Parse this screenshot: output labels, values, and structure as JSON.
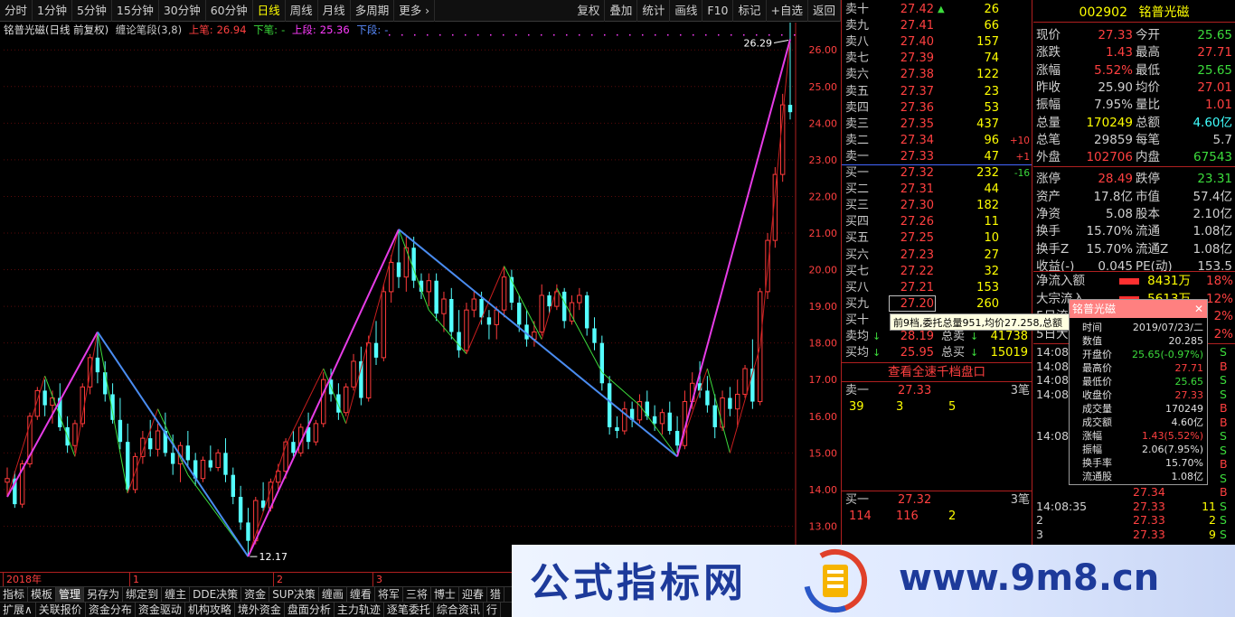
{
  "toolbar": {
    "periods": [
      {
        "label": "分时",
        "active": false
      },
      {
        "label": "1分钟",
        "active": false
      },
      {
        "label": "5分钟",
        "active": false
      },
      {
        "label": "15分钟",
        "active": false
      },
      {
        "label": "30分钟",
        "active": false
      },
      {
        "label": "60分钟",
        "active": false
      },
      {
        "label": "日线",
        "active": true
      },
      {
        "label": "周线",
        "active": false
      },
      {
        "label": "月线",
        "active": false
      },
      {
        "label": "多周期",
        "active": false
      },
      {
        "label": "更多 ›",
        "active": false
      }
    ],
    "tools": [
      "复权",
      "叠加",
      "统计",
      "画线",
      "F10",
      "标记",
      "+自选",
      "返回"
    ]
  },
  "chart_header": {
    "title": "铭普光磁(日线 前复权)",
    "indicator": "缠论笔段(3,8)",
    "up_stroke_label": "上笔:",
    "up_stroke_value": "26.94",
    "down_stroke_label": "下笔:",
    "down_stroke_value": "-",
    "up_segment_label": "上段:",
    "up_segment_value": "25.36",
    "down_segment_label": "下段:",
    "down_segment_value": "-"
  },
  "chart_data": {
    "type": "candlestick",
    "y_axis": {
      "min": 12.0,
      "max": 26.4,
      "ticks": [
        13.0,
        14.0,
        15.0,
        16.0,
        17.0,
        18.0,
        19.0,
        20.0,
        21.0,
        22.0,
        23.0,
        24.0,
        25.0,
        26.0
      ]
    },
    "annotations": {
      "high_label": "26.29",
      "low_label": "12.17"
    },
    "x_labels": [
      "2018年",
      "1",
      "2",
      "3"
    ],
    "candles": [
      [
        14.2,
        14.6,
        13.8,
        14.3
      ],
      [
        14.3,
        14.5,
        13.5,
        13.6
      ],
      [
        13.6,
        14.8,
        13.5,
        14.7
      ],
      [
        14.7,
        16.1,
        14.6,
        16.0
      ],
      [
        16.0,
        16.8,
        15.9,
        16.7
      ],
      [
        16.7,
        17.0,
        16.0,
        16.3
      ],
      [
        16.3,
        16.7,
        15.8,
        16.5
      ],
      [
        16.5,
        16.9,
        15.6,
        15.7
      ],
      [
        15.7,
        16.0,
        15.0,
        15.2
      ],
      [
        15.2,
        15.9,
        15.0,
        15.8
      ],
      [
        15.8,
        16.9,
        15.7,
        16.8
      ],
      [
        16.8,
        17.7,
        16.6,
        17.6
      ],
      [
        17.6,
        18.3,
        16.9,
        17.2
      ],
      [
        17.2,
        17.5,
        16.4,
        16.6
      ],
      [
        16.6,
        16.9,
        15.8,
        15.9
      ],
      [
        15.9,
        16.5,
        15.1,
        15.3
      ],
      [
        15.3,
        15.8,
        13.9,
        14.0
      ],
      [
        14.0,
        15.0,
        13.9,
        14.9
      ],
      [
        14.9,
        15.6,
        14.7,
        15.4
      ],
      [
        15.4,
        15.9,
        14.9,
        15.1
      ],
      [
        15.1,
        15.8,
        14.9,
        15.6
      ],
      [
        15.6,
        16.1,
        14.9,
        15.0
      ],
      [
        15.0,
        15.5,
        14.4,
        14.7
      ],
      [
        14.7,
        15.3,
        14.2,
        15.2
      ],
      [
        15.2,
        15.6,
        14.6,
        14.8
      ],
      [
        14.8,
        15.0,
        14.1,
        14.3
      ],
      [
        14.3,
        14.9,
        14.2,
        14.8
      ],
      [
        14.8,
        15.2,
        14.5,
        14.6
      ],
      [
        14.6,
        15.1,
        14.5,
        15.0
      ],
      [
        15.0,
        15.4,
        14.2,
        14.4
      ],
      [
        14.4,
        14.6,
        13.6,
        13.8
      ],
      [
        13.8,
        14.1,
        12.9,
        13.1
      ],
      [
        13.1,
        13.5,
        12.2,
        12.6
      ],
      [
        12.6,
        13.8,
        12.5,
        13.7
      ],
      [
        13.7,
        14.2,
        13.4,
        13.5
      ],
      [
        13.5,
        14.3,
        13.4,
        14.2
      ],
      [
        14.2,
        14.7,
        14.0,
        14.5
      ],
      [
        14.5,
        15.4,
        14.3,
        15.3
      ],
      [
        15.3,
        15.6,
        14.9,
        15.0
      ],
      [
        15.0,
        15.8,
        14.9,
        15.7
      ],
      [
        15.7,
        16.1,
        15.1,
        15.3
      ],
      [
        15.3,
        15.9,
        15.2,
        15.8
      ],
      [
        15.8,
        17.2,
        15.7,
        17.0
      ],
      [
        17.0,
        17.3,
        16.4,
        16.6
      ],
      [
        16.6,
        16.9,
        15.9,
        16.1
      ],
      [
        16.1,
        16.9,
        16.0,
        16.8
      ],
      [
        16.8,
        17.7,
        16.7,
        17.5
      ],
      [
        17.5,
        17.9,
        16.3,
        16.5
      ],
      [
        16.5,
        18.2,
        16.4,
        18.0
      ],
      [
        18.0,
        18.6,
        17.4,
        17.6
      ],
      [
        17.6,
        19.6,
        17.5,
        19.4
      ],
      [
        19.4,
        20.4,
        19.1,
        20.2
      ],
      [
        20.2,
        21.1,
        19.5,
        19.8
      ],
      [
        19.8,
        20.9,
        19.4,
        20.6
      ],
      [
        20.6,
        20.9,
        19.5,
        19.7
      ],
      [
        19.7,
        19.9,
        19.2,
        19.4
      ],
      [
        19.4,
        19.9,
        19.0,
        19.7
      ],
      [
        19.7,
        19.9,
        18.6,
        18.8
      ],
      [
        18.8,
        19.4,
        18.3,
        19.2
      ],
      [
        19.2,
        19.5,
        18.1,
        18.3
      ],
      [
        18.3,
        18.9,
        17.6,
        17.8
      ],
      [
        17.8,
        19.1,
        17.7,
        18.9
      ],
      [
        18.9,
        19.4,
        18.7,
        19.2
      ],
      [
        19.2,
        19.4,
        18.5,
        18.7
      ],
      [
        18.7,
        18.9,
        18.1,
        18.5
      ],
      [
        18.5,
        19.0,
        18.1,
        18.9
      ],
      [
        18.9,
        20.1,
        18.7,
        19.8
      ],
      [
        19.8,
        20.0,
        18.9,
        19.1
      ],
      [
        19.1,
        19.3,
        18.3,
        18.5
      ],
      [
        18.5,
        18.9,
        17.9,
        18.1
      ],
      [
        18.1,
        18.6,
        17.9,
        18.3
      ],
      [
        18.3,
        19.6,
        18.2,
        19.3
      ],
      [
        19.3,
        19.4,
        18.8,
        19.0
      ],
      [
        19.0,
        19.6,
        18.9,
        19.4
      ],
      [
        19.4,
        19.5,
        18.4,
        18.6
      ],
      [
        18.6,
        19.3,
        18.5,
        19.1
      ],
      [
        19.1,
        19.5,
        18.9,
        19.3
      ],
      [
        19.3,
        19.4,
        18.2,
        18.4
      ],
      [
        18.4,
        18.7,
        17.8,
        18.0
      ],
      [
        18.0,
        18.2,
        16.7,
        16.9
      ],
      [
        16.9,
        17.1,
        15.5,
        15.7
      ],
      [
        15.7,
        16.0,
        15.4,
        15.6
      ],
      [
        15.6,
        16.4,
        15.5,
        16.2
      ],
      [
        16.2,
        16.4,
        15.7,
        15.9
      ],
      [
        15.9,
        16.6,
        15.8,
        16.4
      ],
      [
        16.4,
        16.7,
        15.9,
        16.0
      ],
      [
        16.0,
        16.3,
        15.6,
        15.8
      ],
      [
        15.8,
        16.2,
        15.5,
        16.1
      ],
      [
        16.1,
        16.4,
        15.5,
        15.6
      ],
      [
        15.6,
        16.0,
        15.0,
        15.2
      ],
      [
        15.2,
        16.7,
        15.1,
        16.4
      ],
      [
        16.4,
        17.2,
        16.2,
        16.9
      ],
      [
        16.9,
        17.5,
        16.5,
        16.7
      ],
      [
        16.7,
        17.1,
        16.1,
        16.3
      ],
      [
        16.3,
        16.6,
        15.4,
        15.7
      ],
      [
        15.7,
        16.7,
        15.6,
        16.5
      ],
      [
        16.5,
        16.8,
        16.0,
        16.2
      ],
      [
        16.2,
        17.0,
        15.7,
        16.6
      ],
      [
        16.6,
        17.4,
        16.5,
        17.3
      ],
      [
        17.3,
        18.1,
        16.2,
        16.4
      ],
      [
        16.4,
        19.5,
        16.3,
        19.4
      ],
      [
        19.4,
        21.0,
        19.2,
        20.8
      ],
      [
        20.8,
        22.8,
        20.6,
        22.6
      ],
      [
        22.6,
        24.8,
        22.4,
        24.5
      ],
      [
        24.5,
        26.9,
        24.1,
        24.3
      ]
    ],
    "bi_strokes": [
      [
        0,
        13.8
      ],
      [
        5,
        17.1
      ],
      [
        9,
        14.9
      ],
      [
        12,
        18.3
      ],
      [
        16,
        13.9
      ],
      [
        20,
        16.2
      ],
      [
        24,
        14.4
      ],
      [
        32,
        12.17
      ],
      [
        37,
        15.2
      ],
      [
        42,
        17.3
      ],
      [
        45,
        15.8
      ],
      [
        52,
        21.1
      ],
      [
        56,
        18.9
      ],
      [
        61,
        17.7
      ],
      [
        66,
        20.1
      ],
      [
        71,
        18.1
      ],
      [
        73,
        19.5
      ],
      [
        79,
        17.2
      ],
      [
        84,
        16.3
      ],
      [
        89,
        14.9
      ],
      [
        93,
        17.3
      ],
      [
        96,
        15.0
      ],
      [
        100,
        17.9
      ],
      [
        104,
        26.29
      ]
    ],
    "duan_segments": [
      [
        0,
        13.8
      ],
      [
        12,
        18.3
      ],
      [
        32,
        12.17
      ],
      [
        52,
        21.1
      ],
      [
        89,
        14.9
      ],
      [
        104,
        26.29
      ]
    ]
  },
  "time_axis": [
    "2018年",
    "1",
    "2",
    "3"
  ],
  "orderbook": {
    "asks": [
      {
        "label": "卖十",
        "price": "27.42",
        "vol": "26",
        "chg": "",
        "arrow": "up"
      },
      {
        "label": "卖九",
        "price": "27.41",
        "vol": "66",
        "chg": "",
        "arrow": ""
      },
      {
        "label": "卖八",
        "price": "27.40",
        "vol": "157",
        "chg": "",
        "arrow": ""
      },
      {
        "label": "卖七",
        "price": "27.39",
        "vol": "74",
        "chg": "",
        "arrow": ""
      },
      {
        "label": "卖六",
        "price": "27.38",
        "vol": "122",
        "chg": "",
        "arrow": ""
      },
      {
        "label": "卖五",
        "price": "27.37",
        "vol": "23",
        "chg": "",
        "arrow": ""
      },
      {
        "label": "卖四",
        "price": "27.36",
        "vol": "53",
        "chg": "",
        "arrow": ""
      },
      {
        "label": "卖三",
        "price": "27.35",
        "vol": "437",
        "chg": "",
        "arrow": ""
      },
      {
        "label": "卖二",
        "price": "27.34",
        "vol": "96",
        "chg": "+10",
        "arrow": ""
      },
      {
        "label": "卖一",
        "price": "27.33",
        "vol": "47",
        "chg": "+1",
        "arrow": ""
      }
    ],
    "bids": [
      {
        "label": "买一",
        "price": "27.32",
        "vol": "232",
        "chg": "-16",
        "arrow": ""
      },
      {
        "label": "买二",
        "price": "27.31",
        "vol": "44",
        "chg": "",
        "arrow": ""
      },
      {
        "label": "买三",
        "price": "27.30",
        "vol": "182",
        "chg": "",
        "arrow": ""
      },
      {
        "label": "买四",
        "price": "27.26",
        "vol": "11",
        "chg": "",
        "arrow": ""
      },
      {
        "label": "买五",
        "price": "27.25",
        "vol": "10",
        "chg": "",
        "arrow": ""
      },
      {
        "label": "买六",
        "price": "27.23",
        "vol": "27",
        "chg": "",
        "arrow": ""
      },
      {
        "label": "买七",
        "price": "27.22",
        "vol": "32",
        "chg": "",
        "arrow": ""
      },
      {
        "label": "买八",
        "price": "27.21",
        "vol": "153",
        "chg": "",
        "arrow": ""
      },
      {
        "label": "买九",
        "price": "27.20",
        "vol": "260",
        "chg": "",
        "arrow": ""
      },
      {
        "label": "买十",
        "price": "",
        "vol": "",
        "chg": "",
        "arrow": ""
      }
    ],
    "ask_avg": {
      "label": "卖均",
      "price": "28.19",
      "total_label": "总卖",
      "total": "41738"
    },
    "bid_avg": {
      "label": "买均",
      "price": "25.95",
      "total_label": "总买",
      "total": "15019"
    },
    "quick_book": "查看全速千档盘口",
    "sell1": {
      "label": "卖一",
      "price": "27.33",
      "count": "3笔",
      "nums": [
        "39",
        "3",
        "5"
      ]
    },
    "buy1": {
      "label": "买一",
      "price": "27.32",
      "count": "3笔",
      "nums": [
        "114",
        "116",
        "2"
      ]
    }
  },
  "tooltip": "前9档,委托总量951,均价27.258,总额",
  "quote": {
    "code": "002902",
    "name": "铭普光磁",
    "rows": [
      {
        "l1": "现价",
        "v1": "27.33",
        "c1": "#ff4040",
        "l2": "今开",
        "v2": "25.65",
        "c2": "#3cdc3c"
      },
      {
        "l1": "涨跌",
        "v1": "1.43",
        "c1": "#ff4040",
        "l2": "最高",
        "v2": "27.71",
        "c2": "#ff4040"
      },
      {
        "l1": "涨幅",
        "v1": "5.52%",
        "c1": "#ff4040",
        "l2": "最低",
        "v2": "25.65",
        "c2": "#3cdc3c"
      },
      {
        "l1": "昨收",
        "v1": "25.90",
        "c1": "#d0d0d0",
        "l2": "均价",
        "v2": "27.01",
        "c2": "#ff4040"
      },
      {
        "l1": "振幅",
        "v1": "7.95%",
        "c1": "#d0d0d0",
        "l2": "量比",
        "v2": "1.01",
        "c2": "#ff4040"
      },
      {
        "l1": "总量",
        "v1": "170249",
        "c1": "#ffff00",
        "l2": "总额",
        "v2": "4.60亿",
        "c2": "#40ffff"
      },
      {
        "l1": "总笔",
        "v1": "29859",
        "c1": "#d0d0d0",
        "l2": "每笔",
        "v2": "5.7",
        "c2": "#d0d0d0"
      },
      {
        "l1": "外盘",
        "v1": "102706",
        "c1": "#ff4040",
        "l2": "内盘",
        "v2": "67543",
        "c2": "#3cdc3c"
      },
      {
        "l1": "涨停",
        "v1": "28.49",
        "c1": "#ff4040",
        "l2": "跌停",
        "v2": "23.31",
        "c2": "#3cdc3c"
      },
      {
        "l1": "资产",
        "v1": "17.8亿",
        "c1": "#d0d0d0",
        "l2": "市值",
        "v2": "57.4亿",
        "c2": "#d0d0d0"
      },
      {
        "l1": "净资",
        "v1": "5.08",
        "c1": "#d0d0d0",
        "l2": "股本",
        "v2": "2.10亿",
        "c2": "#d0d0d0"
      },
      {
        "l1": "换手",
        "v1": "15.70%",
        "c1": "#d0d0d0",
        "l2": "流通",
        "v2": "1.08亿",
        "c2": "#d0d0d0"
      },
      {
        "l1": "换手Z",
        "v1": "15.70%",
        "c1": "#d0d0d0",
        "l2": "流通Z",
        "v2": "1.08亿",
        "c2": "#d0d0d0"
      },
      {
        "l1": "收益(-)",
        "v1": "0.045",
        "c1": "#d0d0d0",
        "l2": "PE(动)",
        "v2": "153.5",
        "c2": "#d0d0d0"
      }
    ],
    "flows": [
      {
        "label": "净流入额",
        "value": "8431万",
        "pct": "18%"
      },
      {
        "label": "大宗流入",
        "value": "5613万",
        "pct": "12%"
      },
      {
        "label": "5日流入",
        "value": "",
        "pct": "2%"
      },
      {
        "label": "5日大",
        "value": "",
        "pct": "2%"
      }
    ],
    "ticks": [
      {
        "time": "14:08",
        "price": "",
        "vol": "",
        "bs": "S"
      },
      {
        "time": "14:08",
        "price": "",
        "vol": "",
        "bs": "B"
      },
      {
        "time": "14:08",
        "price": "",
        "vol": "",
        "bs": "S"
      },
      {
        "time": "14:08",
        "price": "",
        "vol": "",
        "bs": "S"
      },
      {
        "time": "",
        "price": "",
        "vol": "",
        "bs": "B"
      },
      {
        "time": "",
        "price": "",
        "vol": "",
        "bs": "B"
      },
      {
        "time": "14:08",
        "price": "",
        "vol": "",
        "bs": "S"
      },
      {
        "time": "",
        "price": "",
        "vol": "",
        "bs": "S"
      },
      {
        "time": "",
        "price": "",
        "vol": "",
        "bs": "B"
      },
      {
        "time": "",
        "price": "",
        "vol": "",
        "bs": "S"
      },
      {
        "time": "",
        "price": "27.34",
        "vol": "",
        "bs": "B"
      },
      {
        "time": "14:08:35",
        "price": "27.33",
        "vol": "11",
        "bs": "S"
      },
      {
        "time": "2",
        "price": "27.33",
        "vol": "2",
        "bs": "S"
      },
      {
        "time": "3",
        "price": "27.33",
        "vol": "9",
        "bs": "S"
      }
    ]
  },
  "popup": {
    "title": "铭普光磁",
    "rows": [
      {
        "label": "时间",
        "value": "2019/07/23/二",
        "color": "#e0e0e0"
      },
      {
        "label": "数值",
        "value": "20.285",
        "color": "#e0e0e0"
      },
      {
        "label": "开盘价",
        "value": "25.65(-0.97%)",
        "color": "#3cdc3c"
      },
      {
        "label": "最高价",
        "value": "27.71",
        "color": "#ff4040"
      },
      {
        "label": "最低价",
        "value": "25.65",
        "color": "#3cdc3c"
      },
      {
        "label": "收盘价",
        "value": "27.33",
        "color": "#ff4040"
      },
      {
        "label": "成交量",
        "value": "170249",
        "color": "#e0e0e0"
      },
      {
        "label": "成交额",
        "value": "4.60亿",
        "color": "#e0e0e0"
      },
      {
        "label": "涨幅",
        "value": "1.43(5.52%)",
        "color": "#ff4040"
      },
      {
        "label": "振幅",
        "value": "2.06(7.95%)",
        "color": "#e0e0e0"
      },
      {
        "label": "换手率",
        "value": "15.70%",
        "color": "#e0e0e0"
      },
      {
        "label": "流通股",
        "value": "1.08亿",
        "color": "#e0e0e0"
      }
    ]
  },
  "bottom_tabs_row1": [
    "指标",
    "模板",
    "管理",
    "另存为",
    "绑定到",
    "缠主",
    "DDE决策",
    "资金",
    "SUP决策",
    "缠画",
    "缠看",
    "将军",
    "三将",
    "博士",
    "迎春",
    "猎"
  ],
  "bottom_tabs_row2": [
    "扩展∧",
    "关联报价",
    "资金分布",
    "资金驱动",
    "机构攻略",
    "境外资金",
    "盘面分析",
    "主力轨迹",
    "逐笔委托",
    "综合资讯",
    "行"
  ],
  "banner": {
    "left_text": "公式指标网",
    "right_text": "www.9m8.cn"
  }
}
